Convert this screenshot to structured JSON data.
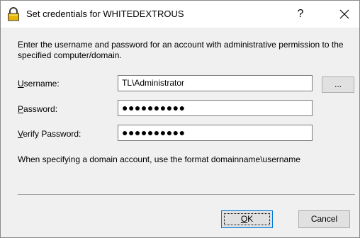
{
  "window": {
    "title": "Set credentials for WHITEDEXTROUS",
    "help_glyph": "?"
  },
  "intro_text": "Enter the username and password for an account with administrative permission to the specified computer/domain.",
  "fields": {
    "username": {
      "label_first": "U",
      "label_rest": "sername:",
      "value": "TL\\Administrator"
    },
    "password": {
      "label_first": "P",
      "label_rest": "assword:",
      "value": "●●●●●●●●●●"
    },
    "verify": {
      "label_first": "V",
      "label_rest": "erify Password:",
      "value": "●●●●●●●●●●"
    }
  },
  "browse_label": "...",
  "hint_text": "When specifying a domain account, use the format domainname\\username",
  "buttons": {
    "ok_first": "O",
    "ok_rest": "K",
    "cancel": "Cancel"
  },
  "icons": {
    "title": "lock-icon",
    "close": "close-icon"
  },
  "colors": {
    "lock_body": "#e8b400",
    "focus_border": "#0078d7"
  }
}
